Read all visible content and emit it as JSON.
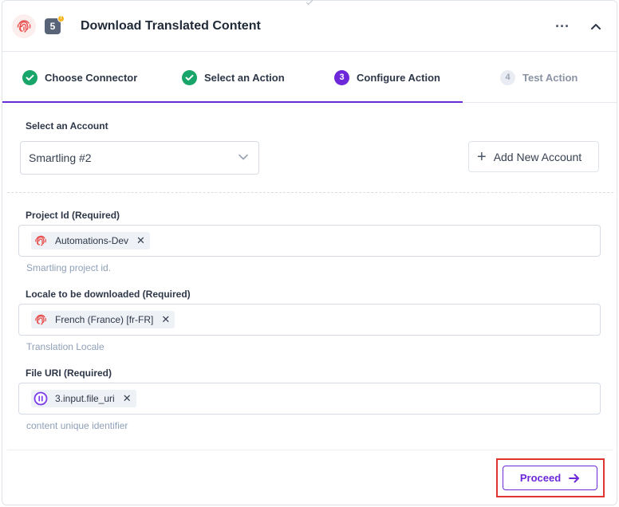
{
  "header": {
    "title": "Download Translated Content",
    "step_number": "5",
    "warning_mark": "!",
    "more_label": "···"
  },
  "steps": [
    {
      "number": "",
      "label": "Choose Connector",
      "state": "done"
    },
    {
      "number": "",
      "label": "Select an Action",
      "state": "done"
    },
    {
      "number": "3",
      "label": "Configure Action",
      "state": "current"
    },
    {
      "number": "4",
      "label": "Test Action",
      "state": "future"
    }
  ],
  "account": {
    "label": "Select an Account",
    "selected": "Smartling #2",
    "add_button": "Add New Account",
    "add_icon": "+"
  },
  "fields": [
    {
      "label": "Project Id (Required)",
      "pill": "Automations-Dev",
      "pill_icon": "fingerprint-icon",
      "hint": "Smartling project id."
    },
    {
      "label": "Locale to be downloaded (Required)",
      "pill": "French (France) [fr-FR]",
      "pill_icon": "fingerprint-icon",
      "hint": "Translation Locale"
    },
    {
      "label": "File URI (Required)",
      "pill": "3.input.file_uri",
      "pill_icon": "pause-circle-icon",
      "hint": "content unique identifier"
    }
  ],
  "remove_glyph": "✕",
  "footer": {
    "proceed": "Proceed"
  },
  "colors": {
    "accent": "#6d28d9",
    "success": "#18a569",
    "highlight": "#e0342f",
    "brand": "#e84c4c"
  }
}
